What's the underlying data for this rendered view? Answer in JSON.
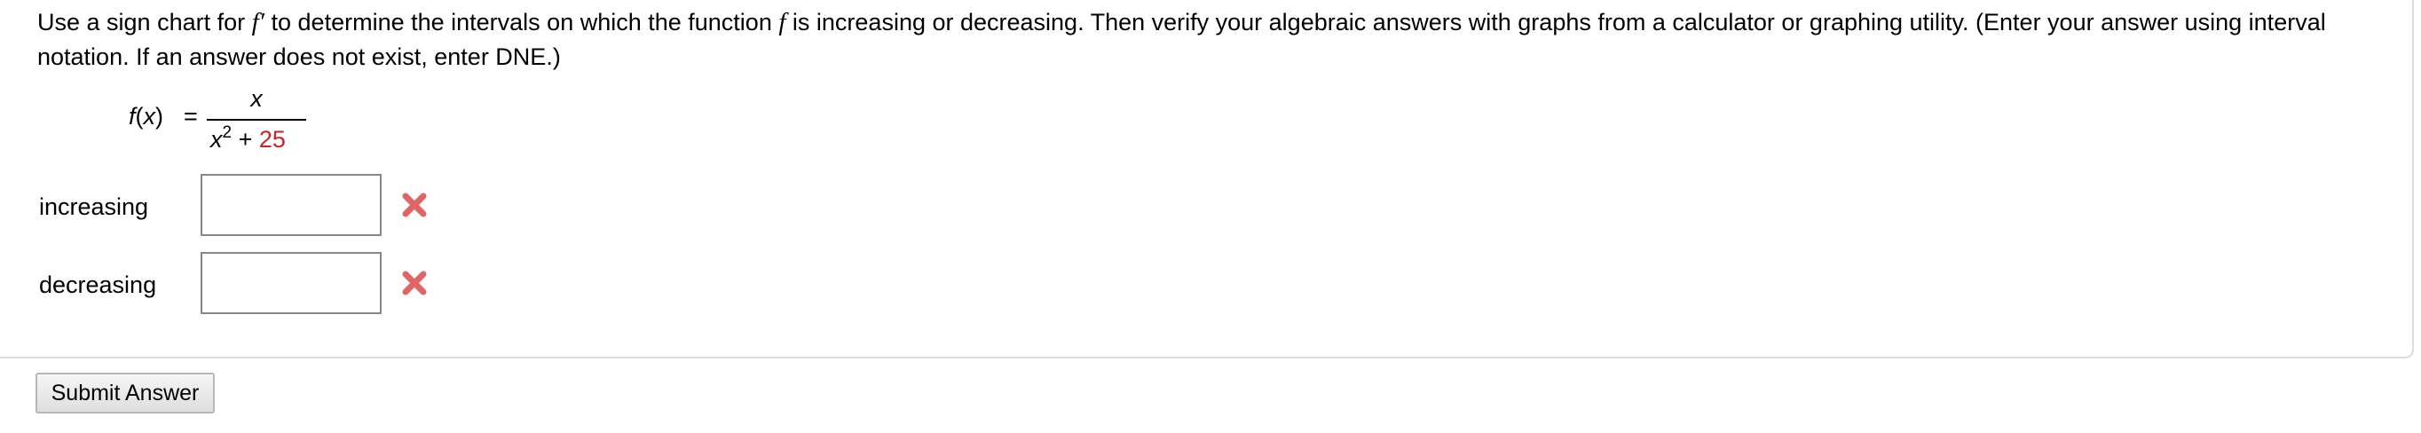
{
  "question": {
    "prompt_part1": "Use a sign chart for ",
    "prompt_fprime": "f′",
    "prompt_part2": " to determine the intervals on which the function ",
    "prompt_f": "f",
    "prompt_part3": " is increasing or decreasing. Then verify your algebraic answers with graphs from a calculator or graphing utility. (Enter your answer using interval notation. If an answer does not exist, enter DNE.)"
  },
  "formula": {
    "function_name": "f",
    "variable": "x",
    "equals": "=",
    "numerator": "x",
    "denominator_var": "x",
    "denominator_exponent": "2",
    "denominator_operator": "+",
    "denominator_constant": "25",
    "constant_color": "#cc2222"
  },
  "answers": [
    {
      "label": "increasing",
      "value": "",
      "status": "incorrect"
    },
    {
      "label": "decreasing",
      "value": "",
      "status": "incorrect"
    }
  ],
  "icons": {
    "incorrect": "cross-icon",
    "incorrect_color": "#e06666"
  },
  "submit": {
    "label": "Submit Answer"
  }
}
